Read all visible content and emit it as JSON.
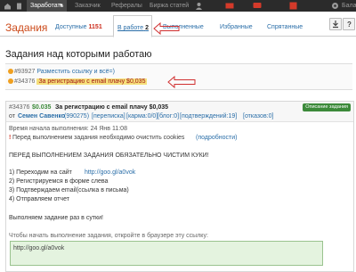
{
  "topbar": {
    "items": [
      "Заработать",
      "Заказчик",
      "Рефералы",
      "Биржа статей",
      "Бала"
    ]
  },
  "tabs": {
    "page_title": "Задания",
    "available_label": "Доступные",
    "available_count": "1151",
    "inwork_label": "В работе",
    "inwork_count": "2",
    "done_label": "Выполненные",
    "favorites_label": "Избранные",
    "hidden_label": "Спрятанные"
  },
  "heading": "Задания над которыми работаю",
  "task_list": [
    {
      "id": "#93927",
      "title": "Разместить ссылку и всё=)"
    },
    {
      "id": "#34376",
      "title": "За регистрацию с email плачу $0,035"
    }
  ],
  "task": {
    "id": "#34376",
    "price": "$0.035",
    "title": "За регистрацию с email плачу $0,035",
    "badge": "Описание задания",
    "owner_prefix": "от",
    "owner": "Семен Савенко",
    "owner_id": "(990275)",
    "meta": [
      "[переписка]",
      "[карма:0/0]",
      "[блог:0]",
      "[подтверждений:19]",
      "[отказов:0]"
    ],
    "started": "Время начала выполнения: 24 Янв 11:08",
    "cookie_warning": "Перед выполнением задания необходимо очистить cookies",
    "cookie_more": "(подробности)",
    "body_header": "ПЕРЕД ВЫПОЛНЕНИЕМ ЗАДАНИЯ ОБЯЗАТЕЛЬНО ЧИСТИМ КУКИ!",
    "step1_prefix": "1) Переходим на сайт",
    "step1_link": "http://goo.gl/a0vok",
    "step2": "2) Регистрируемся в форме слева",
    "step3": "3) Подтверждаем email(ссылка в письма)",
    "step4": "4) Отправляем отчет",
    "repeat_note": "Выполняем задание раз в сутки!",
    "open_hint": "Чтобы начать выполнение задания, откройте в браузере эту ссылку:",
    "url_value": "http://goo.gl/a0vok"
  },
  "colors": {
    "accent": "#cc4a1a",
    "link": "#2a6ea8",
    "highlight": "#f6e07a",
    "badge": "#3c8a3a",
    "arrow": "#d03030"
  }
}
